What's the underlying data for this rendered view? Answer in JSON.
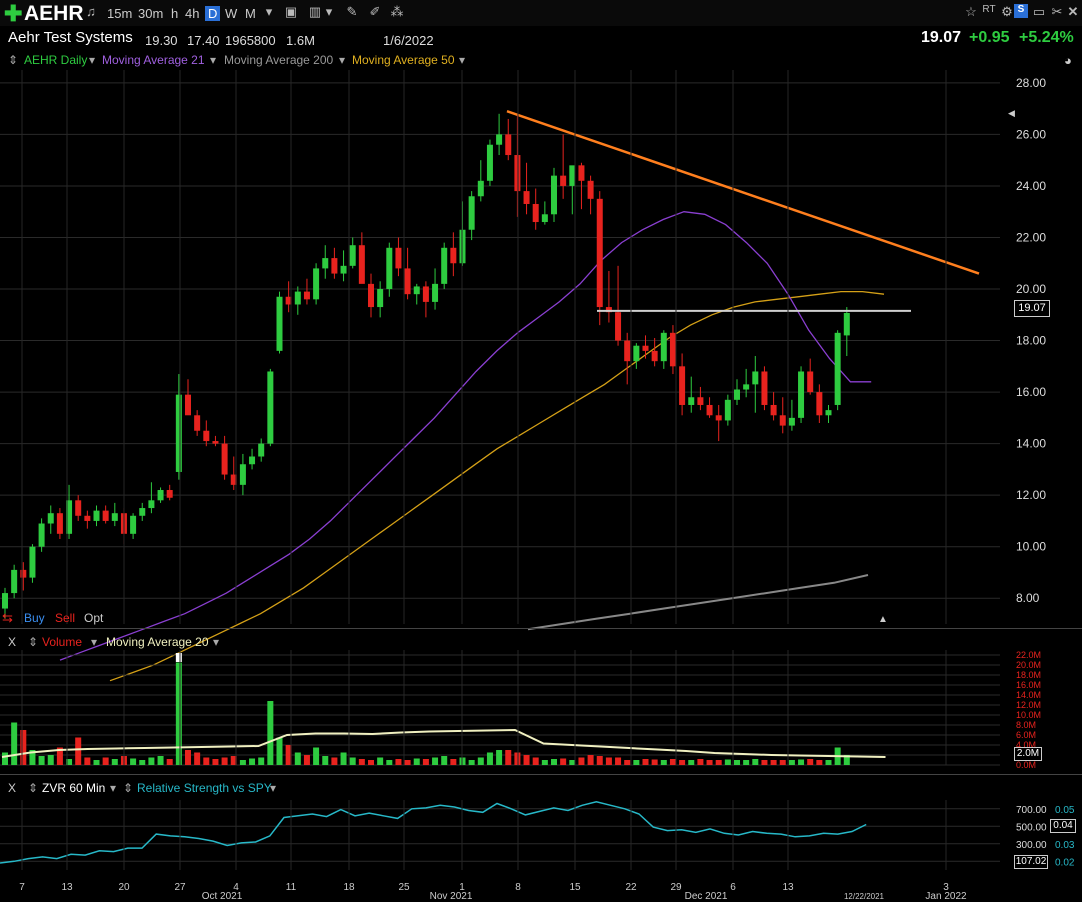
{
  "toolbar": {
    "symbol": "AEHR",
    "timeframes": [
      "15m",
      "30m",
      "h",
      "4h",
      "D",
      "W",
      "M"
    ],
    "active_timeframe": "D"
  },
  "info": {
    "company": "Aehr Test Systems",
    "high": "19.30",
    "low": "17.40",
    "volume": "1965800",
    "avg_volume": "1.6M",
    "date": "1/6/2022",
    "last": "19.07",
    "change": "+0.95",
    "change_pct": "+5.24%"
  },
  "legend": {
    "series": "AEHR Daily",
    "ma21": "Moving Average 21",
    "ma200": "Moving Average 200",
    "ma50": "Moving Average 50"
  },
  "trade_buttons": {
    "buy": "Buy",
    "sell": "Sell",
    "opt": "Opt"
  },
  "volume_panel": {
    "close": "X",
    "title": "Volume",
    "ma": "Moving Average 20",
    "last_box": "2.0M"
  },
  "rs_panel": {
    "close": "X",
    "title": "ZVR 60 Min",
    "rs": "Relative Strength vs SPY",
    "box1": "0.04",
    "box2": "107.02"
  },
  "colors": {
    "up": "#2ecc40",
    "down": "#e8231e",
    "ma21": "#8a3fd1",
    "ma50": "#d4a017",
    "ma200": "#888888",
    "trend": "#ff7f1e",
    "rs": "#27b8c8",
    "volma": "#f0f0c0"
  },
  "chart_data": [
    {
      "type": "candlestick",
      "title": "AEHR Daily",
      "ylim": [
        7,
        28.5
      ],
      "y_ticks": [
        "28.00",
        "26.00",
        "24.00",
        "22.00",
        "20.00",
        "18.00",
        "16.00",
        "14.00",
        "12.00",
        "10.00",
        "8.00"
      ],
      "x_ticks": [
        "7",
        "13",
        "20",
        "27",
        "Oct 2021",
        "4",
        "11",
        "18",
        "25",
        "Nov 2021",
        "1",
        "8",
        "15",
        "22",
        "29",
        "Dec 2021",
        "6",
        "13",
        "12/22/2021",
        "3",
        "Jan 2022"
      ],
      "candles": [
        [
          7.6,
          8.4,
          7.2,
          8.2
        ],
        [
          8.2,
          9.3,
          8.0,
          9.1
        ],
        [
          9.1,
          9.4,
          8.3,
          8.8
        ],
        [
          8.8,
          10.1,
          8.6,
          10.0
        ],
        [
          10.0,
          11.1,
          9.8,
          10.9
        ],
        [
          10.9,
          11.6,
          10.5,
          11.3
        ],
        [
          11.3,
          11.5,
          10.3,
          10.5
        ],
        [
          10.5,
          12.4,
          10.3,
          11.8
        ],
        [
          11.8,
          12.0,
          11.0,
          11.2
        ],
        [
          11.2,
          11.4,
          10.7,
          11.0
        ],
        [
          11.0,
          11.6,
          10.8,
          11.4
        ],
        [
          11.4,
          11.6,
          10.9,
          11.0
        ],
        [
          11.0,
          11.7,
          10.8,
          11.3
        ],
        [
          11.3,
          11.5,
          10.1,
          10.5
        ],
        [
          10.5,
          11.3,
          10.3,
          11.2
        ],
        [
          11.2,
          11.7,
          11.0,
          11.5
        ],
        [
          11.5,
          12.5,
          11.3,
          11.8
        ],
        [
          11.8,
          12.3,
          11.7,
          12.2
        ],
        [
          12.2,
          12.4,
          11.8,
          11.9
        ],
        [
          12.9,
          16.7,
          12.6,
          15.9
        ],
        [
          15.9,
          16.5,
          15.2,
          15.1
        ],
        [
          15.1,
          15.3,
          14.3,
          14.5
        ],
        [
          14.5,
          14.9,
          13.9,
          14.1
        ],
        [
          14.1,
          14.3,
          13.9,
          14.0
        ],
        [
          14.0,
          14.3,
          12.6,
          12.8
        ],
        [
          12.8,
          13.5,
          12.2,
          12.4
        ],
        [
          12.4,
          13.6,
          12.0,
          13.2
        ],
        [
          13.2,
          13.8,
          13.0,
          13.5
        ],
        [
          13.5,
          14.2,
          13.3,
          14.0
        ],
        [
          14.0,
          16.9,
          13.9,
          16.8
        ],
        [
          17.6,
          19.9,
          17.5,
          19.7
        ],
        [
          19.7,
          20.3,
          19.1,
          19.4
        ],
        [
          19.4,
          20.1,
          19.0,
          19.9
        ],
        [
          19.9,
          20.4,
          19.4,
          19.6
        ],
        [
          19.6,
          21.0,
          19.4,
          20.8
        ],
        [
          20.8,
          21.7,
          20.4,
          21.2
        ],
        [
          21.2,
          21.6,
          20.4,
          20.6
        ],
        [
          20.6,
          21.5,
          20.3,
          20.9
        ],
        [
          20.9,
          22.0,
          20.8,
          21.7
        ],
        [
          21.7,
          22.2,
          20.5,
          20.2
        ],
        [
          20.2,
          20.6,
          18.9,
          19.3
        ],
        [
          19.3,
          20.3,
          18.9,
          20.0
        ],
        [
          20.0,
          21.8,
          19.7,
          21.6
        ],
        [
          21.6,
          22.0,
          20.5,
          20.8
        ],
        [
          20.8,
          21.6,
          19.6,
          19.8
        ],
        [
          19.8,
          20.2,
          19.4,
          20.1
        ],
        [
          20.1,
          20.3,
          18.9,
          19.5
        ],
        [
          19.5,
          20.8,
          19.2,
          20.2
        ],
        [
          20.2,
          21.8,
          20.0,
          21.6
        ],
        [
          21.6,
          22.2,
          20.5,
          21.0
        ],
        [
          21.0,
          23.4,
          20.9,
          22.3
        ],
        [
          22.3,
          23.8,
          21.9,
          23.6
        ],
        [
          23.6,
          25.0,
          23.4,
          24.2
        ],
        [
          24.2,
          25.8,
          24.0,
          25.6
        ],
        [
          25.6,
          26.8,
          25.2,
          26.0
        ],
        [
          26.0,
          26.6,
          25.0,
          25.2
        ],
        [
          25.2,
          26.8,
          22.8,
          23.8
        ],
        [
          23.8,
          24.9,
          22.9,
          23.3
        ],
        [
          23.3,
          23.9,
          22.3,
          22.6
        ],
        [
          22.6,
          23.4,
          22.5,
          22.9
        ],
        [
          22.9,
          24.7,
          22.6,
          24.4
        ],
        [
          24.4,
          26.0,
          23.5,
          24.0
        ],
        [
          24.0,
          24.7,
          22.9,
          24.8
        ],
        [
          24.8,
          24.9,
          23.1,
          24.2
        ],
        [
          24.2,
          24.4,
          22.9,
          23.5
        ],
        [
          23.5,
          23.8,
          18.6,
          19.3
        ],
        [
          19.3,
          20.7,
          18.7,
          19.1
        ],
        [
          19.1,
          20.9,
          17.8,
          18.0
        ],
        [
          18.0,
          18.3,
          16.3,
          17.2
        ],
        [
          17.2,
          17.9,
          16.9,
          17.8
        ],
        [
          17.8,
          18.2,
          17.3,
          17.6
        ],
        [
          17.6,
          18.1,
          17.0,
          17.2
        ],
        [
          17.2,
          18.4,
          16.9,
          18.3
        ],
        [
          18.3,
          18.6,
          16.7,
          17.0
        ],
        [
          17.0,
          17.5,
          15.1,
          15.5
        ],
        [
          15.5,
          16.6,
          15.2,
          15.8
        ],
        [
          15.8,
          16.2,
          15.3,
          15.5
        ],
        [
          15.5,
          15.8,
          15.0,
          15.1
        ],
        [
          15.1,
          15.5,
          14.1,
          14.9
        ],
        [
          14.9,
          15.9,
          14.7,
          15.7
        ],
        [
          15.7,
          16.5,
          15.5,
          16.1
        ],
        [
          16.1,
          16.9,
          15.8,
          16.3
        ],
        [
          16.3,
          17.4,
          15.2,
          16.8
        ],
        [
          16.8,
          17.0,
          15.3,
          15.5
        ],
        [
          15.5,
          16.0,
          14.9,
          15.1
        ],
        [
          15.1,
          15.8,
          14.4,
          14.7
        ],
        [
          14.7,
          15.7,
          14.5,
          15.0
        ],
        [
          15.0,
          17.0,
          14.8,
          16.8
        ],
        [
          16.8,
          17.3,
          15.9,
          16.0
        ],
        [
          16.0,
          16.3,
          14.8,
          15.1
        ],
        [
          15.1,
          15.5,
          14.8,
          15.3
        ],
        [
          15.5,
          18.4,
          15.3,
          18.3
        ],
        [
          18.2,
          19.3,
          17.4,
          19.07
        ]
      ],
      "ma21": [
        5.6,
        5.9,
        6.2,
        6.5,
        6.8,
        7.1,
        7.4,
        7.8,
        8.2,
        8.7,
        9.2,
        9.7,
        10.3,
        11.0,
        11.8,
        12.6,
        13.4,
        14.2,
        15.0,
        15.9,
        16.8,
        17.6,
        18.3,
        18.9,
        19.5,
        20.2,
        21.1,
        21.8,
        22.3,
        22.7,
        23.0,
        22.9,
        22.5,
        21.8,
        21.0,
        19.8,
        18.4,
        17.3,
        16.4,
        16.4
      ],
      "ma50": [
        4.8,
        5.1,
        5.4,
        5.8,
        6.2,
        6.6,
        7.0,
        7.4,
        7.9,
        8.4,
        9.0,
        9.6,
        10.2,
        10.8,
        11.4,
        12.0,
        12.6,
        13.2,
        13.8,
        14.3,
        14.8,
        15.3,
        15.8,
        16.3,
        16.9,
        17.5,
        18.1,
        18.6,
        19.0,
        19.3,
        19.5,
        19.6,
        19.7,
        19.8,
        19.9,
        19.9,
        19.8
      ],
      "ma200": [
        6.8,
        7.0,
        7.2,
        7.4,
        7.6,
        7.8,
        8.0,
        8.2,
        8.4,
        8.6,
        8.9
      ],
      "trendline": [
        [
          26.9,
          20.6
        ]
      ],
      "resistance": 19.15
    },
    {
      "type": "bar",
      "title": "Volume",
      "y_ticks": [
        "22.0M",
        "20.0M",
        "18.0M",
        "16.0M",
        "14.0M",
        "12.0M",
        "10.0M",
        "8.0M",
        "6.0M",
        "4.0M",
        "2.0M",
        "0.0M"
      ],
      "ylim": [
        0,
        22
      ],
      "values": [
        2.5,
        8.5,
        7.0,
        3.0,
        1.8,
        2.0,
        3.5,
        1.2,
        5.5,
        1.5,
        1.0,
        1.5,
        1.2,
        1.8,
        1.3,
        1.0,
        1.5,
        1.8,
        1.2,
        20.5,
        3.0,
        2.5,
        1.5,
        1.2,
        1.5,
        1.8,
        1.0,
        1.3,
        1.5,
        12.8,
        5.5,
        4.0,
        2.5,
        2.0,
        3.5,
        1.8,
        1.5,
        2.5,
        1.5,
        1.2,
        1.0,
        1.5,
        1.0,
        1.2,
        1.0,
        1.3,
        1.2,
        1.5,
        1.8,
        1.2,
        1.5,
        1.0,
        1.5,
        2.5,
        3.0,
        3.0,
        2.5,
        2.0,
        1.5,
        1.0,
        1.2,
        1.3,
        1.0,
        1.5,
        2.0,
        1.8,
        1.5,
        1.5,
        1.0,
        1.0,
        1.2,
        1.1,
        1.0,
        1.2,
        1.0,
        1.0,
        1.2,
        1.0,
        1.0,
        1.1,
        1.0,
        1.0,
        1.2,
        1.0,
        1.0,
        1.0,
        1.0,
        1.1,
        1.2,
        1.0,
        1.0,
        3.5,
        2.0
      ],
      "ma20": [
        1.6,
        2.5,
        3.0,
        3.2,
        3.3,
        3.4,
        3.5,
        3.6,
        3.7,
        3.8,
        6.0,
        6.3,
        6.3,
        6.2,
        6.5,
        6.7,
        6.8,
        6.9,
        7.0,
        4.3,
        4.0,
        3.7,
        3.4,
        3.1,
        2.8,
        2.4,
        2.2,
        2.0,
        1.9,
        1.8,
        1.7,
        1.6
      ]
    },
    {
      "type": "line",
      "title": "Relative Strength vs SPY",
      "y_ticks": [
        "700.00",
        "500.00",
        "300.00",
        "100.00"
      ],
      "right_ticks": [
        "0.05",
        "0.04",
        "0.03",
        "0.02"
      ],
      "ylim": [
        0,
        800
      ],
      "values": [
        80,
        100,
        130,
        150,
        130,
        180,
        170,
        220,
        210,
        250,
        250,
        410,
        390,
        380,
        360,
        330,
        280,
        310,
        320,
        390,
        600,
        620,
        640,
        610,
        690,
        620,
        650,
        620,
        590,
        700,
        710,
        740,
        720,
        680,
        660,
        760,
        700,
        630,
        670,
        710,
        680,
        740,
        780,
        740,
        700,
        640,
        490,
        450,
        460,
        430,
        470,
        420,
        400,
        440,
        420,
        410,
        380,
        390,
        420,
        410,
        440,
        520
      ]
    }
  ]
}
